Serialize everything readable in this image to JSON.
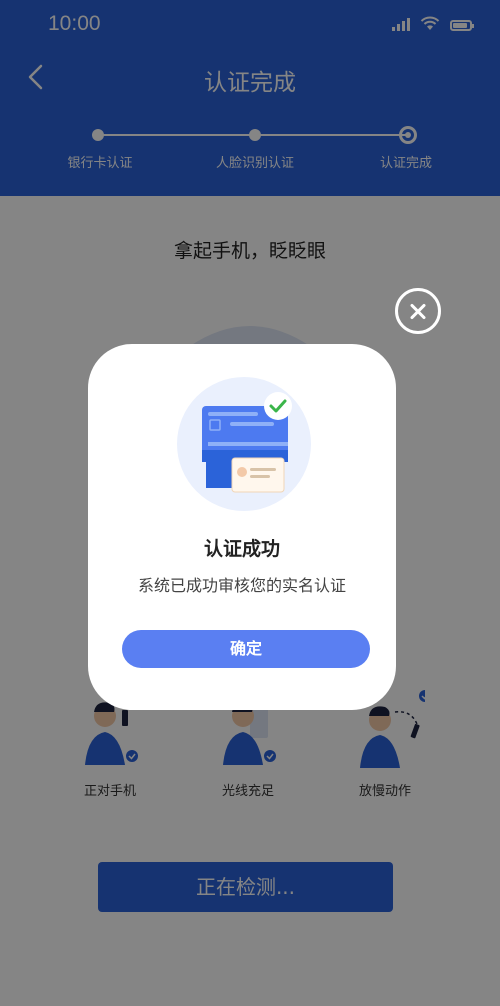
{
  "status_bar": {
    "time": "10:00"
  },
  "nav": {
    "title": "认证完成"
  },
  "steps": [
    {
      "label": "银行卡认证"
    },
    {
      "label": "人脸识别认证"
    },
    {
      "label": "认证完成"
    }
  ],
  "content": {
    "instruction": "拿起手机，眨眨眼",
    "tips": [
      {
        "label": "正对手机"
      },
      {
        "label": "光线充足"
      },
      {
        "label": "放慢动作"
      }
    ],
    "detect_button": "正在检测..."
  },
  "modal": {
    "title": "认证成功",
    "message": "系统已成功审核您的实名认证",
    "confirm_label": "确定"
  },
  "colors": {
    "primary": "#2b63d9",
    "button": "#5a7ff2",
    "check": "#3bb54a"
  }
}
